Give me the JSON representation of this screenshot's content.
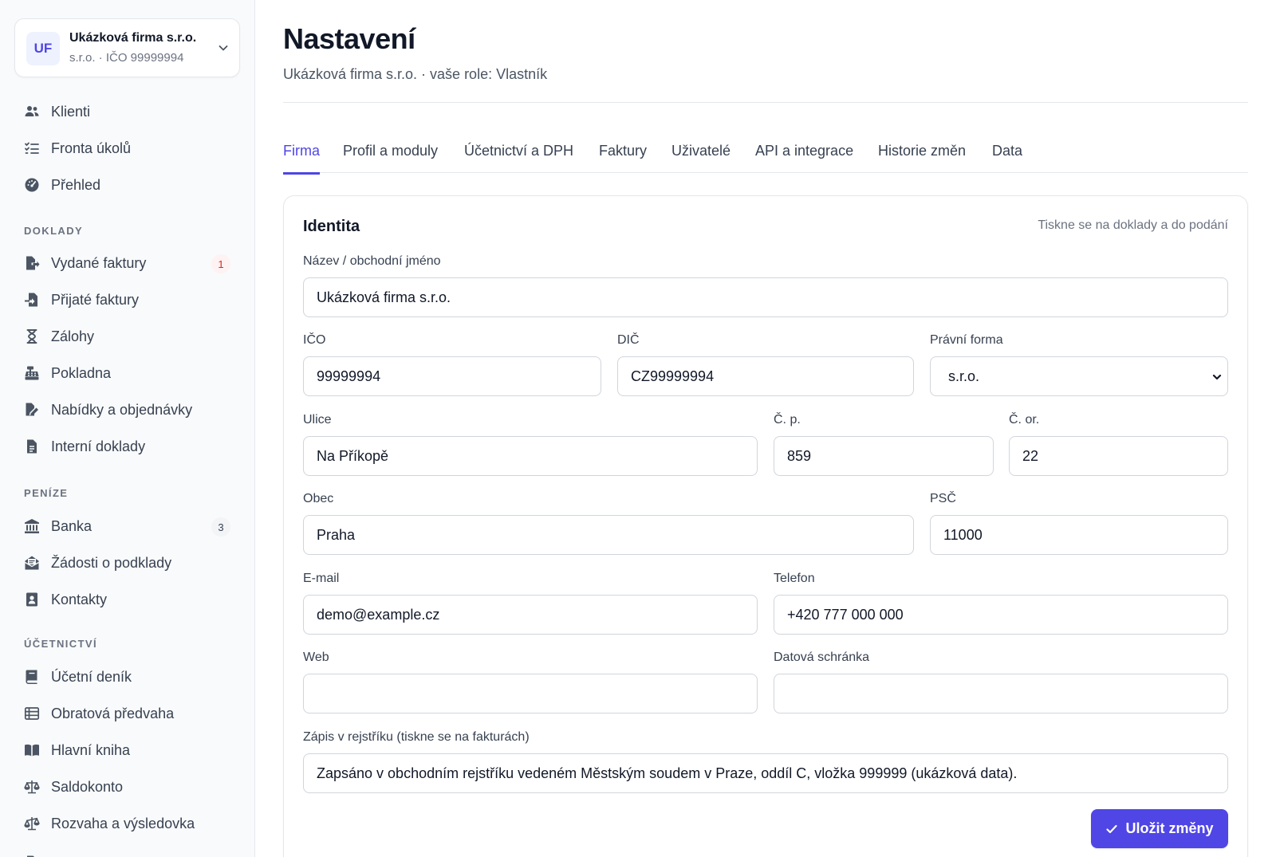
{
  "org": {
    "initials": "UF",
    "name": "Ukázková firma s.r.o.",
    "subtitle": "s.r.o. · IČO 99999994"
  },
  "sidebar": {
    "top_items": [
      {
        "label": "Klienti",
        "icon": "users-icon"
      },
      {
        "label": "Fronta úkolů",
        "icon": "task-list-icon"
      },
      {
        "label": "Přehled",
        "icon": "dashboard-gauge-icon"
      }
    ],
    "sections": [
      {
        "title": "DOKLADY",
        "items": [
          {
            "label": "Vydané faktury",
            "icon": "file-export-icon",
            "badge": "1"
          },
          {
            "label": "Přijaté faktury",
            "icon": "file-import-icon"
          },
          {
            "label": "Zálohy",
            "icon": "hourglass-icon"
          },
          {
            "label": "Pokladna",
            "icon": "cash-register-icon"
          },
          {
            "label": "Nabídky a objednávky",
            "icon": "file-signature-icon"
          },
          {
            "label": "Interní doklady",
            "icon": "file-text-icon"
          }
        ]
      },
      {
        "title": "PENÍZE",
        "items": [
          {
            "label": "Banka",
            "icon": "bank-icon",
            "badge": "3"
          },
          {
            "label": "Žádosti o podklady",
            "icon": "envelope-open-icon"
          },
          {
            "label": "Kontakty",
            "icon": "address-book-icon"
          }
        ]
      },
      {
        "title": "ÚČETNICTVÍ",
        "items": [
          {
            "label": "Účetní deník",
            "icon": "journal-book-icon"
          },
          {
            "label": "Obratová předvaha",
            "icon": "table-list-icon"
          },
          {
            "label": "Hlavní kniha",
            "icon": "open-book-icon"
          },
          {
            "label": "Saldokonto",
            "icon": "scale-balanced-icon"
          },
          {
            "label": "Rozvaha a výsledovka",
            "icon": "scale-unbalanced-icon"
          }
        ]
      }
    ]
  },
  "page": {
    "title": "Nastavení",
    "subtitle": "Ukázková firma s.r.o. · vaše role: Vlastník"
  },
  "tabs": [
    {
      "label": "Firma",
      "active": true
    },
    {
      "label": "Profil a moduly"
    },
    {
      "label": "Účetnictví a DPH"
    },
    {
      "label": "Faktury"
    },
    {
      "label": "Uživatelé"
    },
    {
      "label": "API a integrace"
    },
    {
      "label": "Historie změn"
    },
    {
      "label": "Data"
    }
  ],
  "identity": {
    "title": "Identita",
    "hint": "Tiskne se na doklady a do podání",
    "fields": {
      "name": {
        "label": "Název / obchodní jméno",
        "value": "Ukázková firma s.r.o."
      },
      "ico": {
        "label": "IČO",
        "value": "99999994"
      },
      "dic": {
        "label": "DIČ",
        "value": "CZ99999994"
      },
      "legal_form": {
        "label": "Právní forma",
        "value": "s.r.o."
      },
      "street": {
        "label": "Ulice",
        "value": "Na Příkopě"
      },
      "house_number": {
        "label": "Č. p.",
        "value": "859"
      },
      "orientation_number": {
        "label": "Č. or.",
        "value": "22"
      },
      "city": {
        "label": "Obec",
        "value": "Praha"
      },
      "zip": {
        "label": "PSČ",
        "value": "11000"
      },
      "email": {
        "label": "E-mail",
        "value": "demo@example.cz"
      },
      "phone": {
        "label": "Telefon",
        "value": "+420 777 000 000"
      },
      "web": {
        "label": "Web",
        "value": ""
      },
      "data_box": {
        "label": "Datová schránka",
        "value": ""
      },
      "registry": {
        "label": "Zápis v rejstříku (tiskne se na fakturách)",
        "value": "Zapsáno v obchodním rejstříku vedeném Městským soudem v Praze, oddíl C, vložka 999999 (ukázková data)."
      }
    },
    "save_label": "Uložit změny"
  },
  "colors": {
    "accent": "#4f46e5",
    "badge_red": "#dc2626"
  }
}
